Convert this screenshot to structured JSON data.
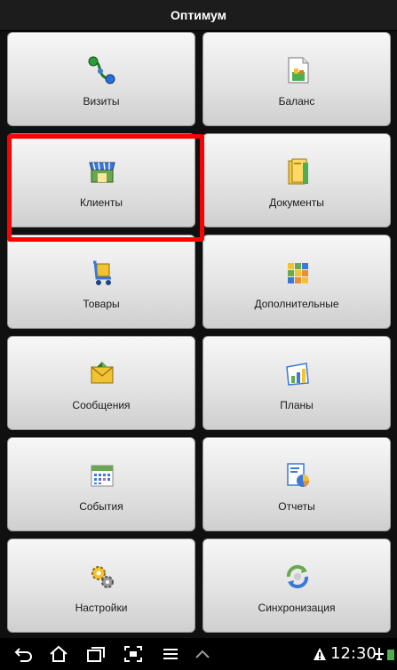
{
  "app": {
    "title": "Оптимум"
  },
  "menu": {
    "items": [
      {
        "label": "Визиты",
        "icon": "visits-route-icon"
      },
      {
        "label": "Баланс",
        "icon": "balance-document-icon"
      },
      {
        "label": "Клиенты",
        "icon": "clients-shop-icon"
      },
      {
        "label": "Документы",
        "icon": "documents-folder-icon"
      },
      {
        "label": "Товары",
        "icon": "goods-cart-icon"
      },
      {
        "label": "Дополнительные",
        "icon": "additional-grid-icon"
      },
      {
        "label": "Сообщения",
        "icon": "messages-envelope-icon"
      },
      {
        "label": "Планы",
        "icon": "plans-chart-icon"
      },
      {
        "label": "События",
        "icon": "events-calendar-icon"
      },
      {
        "label": "Отчеты",
        "icon": "reports-piechart-icon"
      },
      {
        "label": "Настройки",
        "icon": "settings-gears-icon"
      },
      {
        "label": "Синхронизация",
        "icon": "sync-arrows-icon"
      }
    ],
    "highlighted_index": 2,
    "highlight_color": "#ff0000"
  },
  "status_bar": {
    "time": "12:30"
  }
}
